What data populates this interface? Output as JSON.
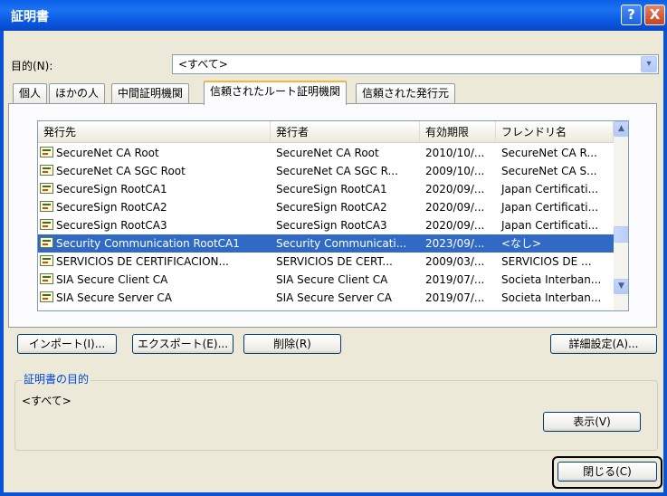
{
  "window": {
    "title": "証明書",
    "help_glyph": "?",
    "close_glyph": "X"
  },
  "purpose": {
    "label": "目的(N):",
    "selected": "<すべて>",
    "arrow": "▾"
  },
  "tabs": [
    {
      "label": "個人"
    },
    {
      "label": "ほかの人"
    },
    {
      "label": "中間証明機関"
    },
    {
      "label": "信頼されたルート証明機関"
    },
    {
      "label": "信頼された発行元"
    }
  ],
  "active_tab": "信頼されたルート証明機関",
  "table": {
    "columns": [
      "発行先",
      "発行者",
      "有効期限",
      "フレンドリ名"
    ],
    "rows": [
      {
        "issued_to": "SecureNet CA Root",
        "issued_by": "SecureNet CA Root",
        "expires": "2010/10/...",
        "friendly": "SecureNet CA R..."
      },
      {
        "issued_to": "SecureNet CA SGC Root",
        "issued_by": "SecureNet CA SGC R...",
        "expires": "2009/10/...",
        "friendly": "SecureNet CA S..."
      },
      {
        "issued_to": "SecureSign RootCA1",
        "issued_by": "SecureSign RootCA1",
        "expires": "2020/09/...",
        "friendly": "Japan Certificati..."
      },
      {
        "issued_to": "SecureSign RootCA2",
        "issued_by": "SecureSign RootCA2",
        "expires": "2020/09/...",
        "friendly": "Japan Certificati..."
      },
      {
        "issued_to": "SecureSign RootCA3",
        "issued_by": "SecureSign RootCA3",
        "expires": "2020/09/...",
        "friendly": "Japan Certificati..."
      },
      {
        "issued_to": "Security Communication RootCA1",
        "issued_by": "Security Communicati...",
        "expires": "2023/09/...",
        "friendly": "<なし>"
      },
      {
        "issued_to": "SERVICIOS DE CERTIFICACION...",
        "issued_by": "SERVICIOS DE CERT...",
        "expires": "2009/03/...",
        "friendly": "SERVICIOS DE ..."
      },
      {
        "issued_to": "SIA Secure Client CA",
        "issued_by": "SIA Secure Client CA",
        "expires": "2019/07/...",
        "friendly": "Societa Interban..."
      },
      {
        "issued_to": "SIA Secure Server CA",
        "issued_by": "SIA Secure Server CA",
        "expires": "2019/07/...",
        "friendly": "Societa Interban..."
      }
    ],
    "selected_row": 5,
    "scroll_up": "▲",
    "scroll_down": "▼"
  },
  "buttons": {
    "import": "インポート(I)...",
    "export": "エクスポート(E)...",
    "delete": "削除(R)",
    "advanced": "詳細設定(A)...",
    "view": "表示(V)",
    "close": "閉じる(C)"
  },
  "purpose_group": {
    "label": "証明書の目的",
    "value": "<すべて>"
  },
  "colors": {
    "titlebar": "#0a5fe8",
    "dialog_bg": "#ece9d8",
    "selection": "#316ac5",
    "group_label": "#0046d5"
  }
}
